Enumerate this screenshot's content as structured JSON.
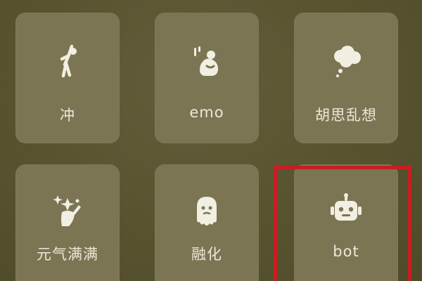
{
  "tiles": [
    {
      "label": "冲",
      "icon": "running-person-icon"
    },
    {
      "label": "emo",
      "icon": "sad-hugging-knees-icon"
    },
    {
      "label": "胡思乱想",
      "icon": "thought-cloud-icon"
    },
    {
      "label": "元气满满",
      "icon": "energetic-sparkle-person-icon"
    },
    {
      "label": "融化",
      "icon": "melting-ghost-icon"
    },
    {
      "label": "bot",
      "icon": "robot-head-icon"
    }
  ],
  "highlight_color": "#c61f22",
  "tile_color": "#7b7554",
  "background_color": "#58532f"
}
